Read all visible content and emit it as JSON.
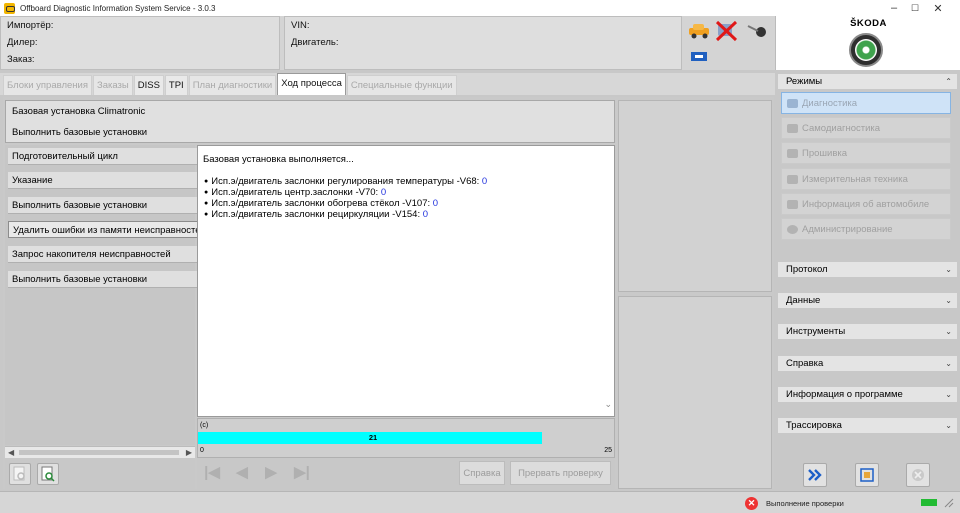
{
  "window": {
    "title": "Offboard Diagnostic Information System Service - 3.0.3",
    "minimize": "–",
    "maximize": "☐",
    "close": "✕"
  },
  "header": {
    "importer_label": "Импортёр:",
    "dealer_label": "Дилер:",
    "order_label": "Заказ:",
    "vin_label": "VIN:",
    "engine_label": "Двигатель:"
  },
  "logo": {
    "brand": "ŠKODA"
  },
  "tabs": [
    {
      "label": "Блоки управления",
      "state": "disabled"
    },
    {
      "label": "Заказы",
      "state": "disabled"
    },
    {
      "label": "DISS",
      "state": "enabled"
    },
    {
      "label": "TPI",
      "state": "enabled"
    },
    {
      "label": "План диагностики",
      "state": "disabled"
    },
    {
      "label": "Ход процесса",
      "state": "active"
    },
    {
      "label": "Специальные функции",
      "state": "disabled"
    }
  ],
  "title_box": {
    "line1": "Базовая установка Climatronic",
    "line2": "Выполнить базовые установки"
  },
  "steps": [
    "Подготовительный цикл",
    "Указание",
    "Выполнить базовые установки",
    "Удалить ошибки из памяти неисправностей",
    "Запрос накопителя неисправностей",
    "Выполнить базовые установки"
  ],
  "content": {
    "heading": "Базовая установка выполняется...",
    "items": [
      {
        "text": "Исп.э/двигатель заслонки регулирования температуры -V68:",
        "value": "0"
      },
      {
        "text": "Исп.э/двигатель центр.заслонки -V70:",
        "value": "0"
      },
      {
        "text": "Исп.э/двигатель заслонки обогрева стёкол -V107:",
        "value": "0"
      },
      {
        "text": "Исп.э/двигатель заслонки рециркуляции -V154:",
        "value": "0"
      }
    ]
  },
  "progress": {
    "label": "(c)",
    "value": 21,
    "value_text": "21",
    "min_text": "0",
    "max_text": "25",
    "min": 0,
    "max": 25
  },
  "buttons": {
    "help": "Справка",
    "abort": "Прервать проверку"
  },
  "sidebar": {
    "modes_label": "Режимы",
    "modes": [
      {
        "label": "Диагностика",
        "icon": "stethoscope-icon",
        "selected": true
      },
      {
        "label": "Самодиагностика",
        "icon": "car-icon",
        "selected": false
      },
      {
        "label": "Прошивка",
        "icon": "flash-icon",
        "selected": false
      },
      {
        "label": "Измерительная техника",
        "icon": "gauge-icon",
        "selected": false
      },
      {
        "label": "Информация об автомобиле",
        "icon": "info-icon",
        "selected": false
      },
      {
        "label": "Администрирование",
        "icon": "gear-icon",
        "selected": false
      }
    ],
    "sections": [
      "Протокол",
      "Данные",
      "Инструменты",
      "Справка",
      "Информация о программе",
      "Трассировка"
    ]
  },
  "status": {
    "text": "Выполнение проверки",
    "error_glyph": "✕"
  },
  "colors": {
    "progress_fill": "#00ffff",
    "value_blue": "#2233dd",
    "selected_mode": "#cfe3f7"
  }
}
